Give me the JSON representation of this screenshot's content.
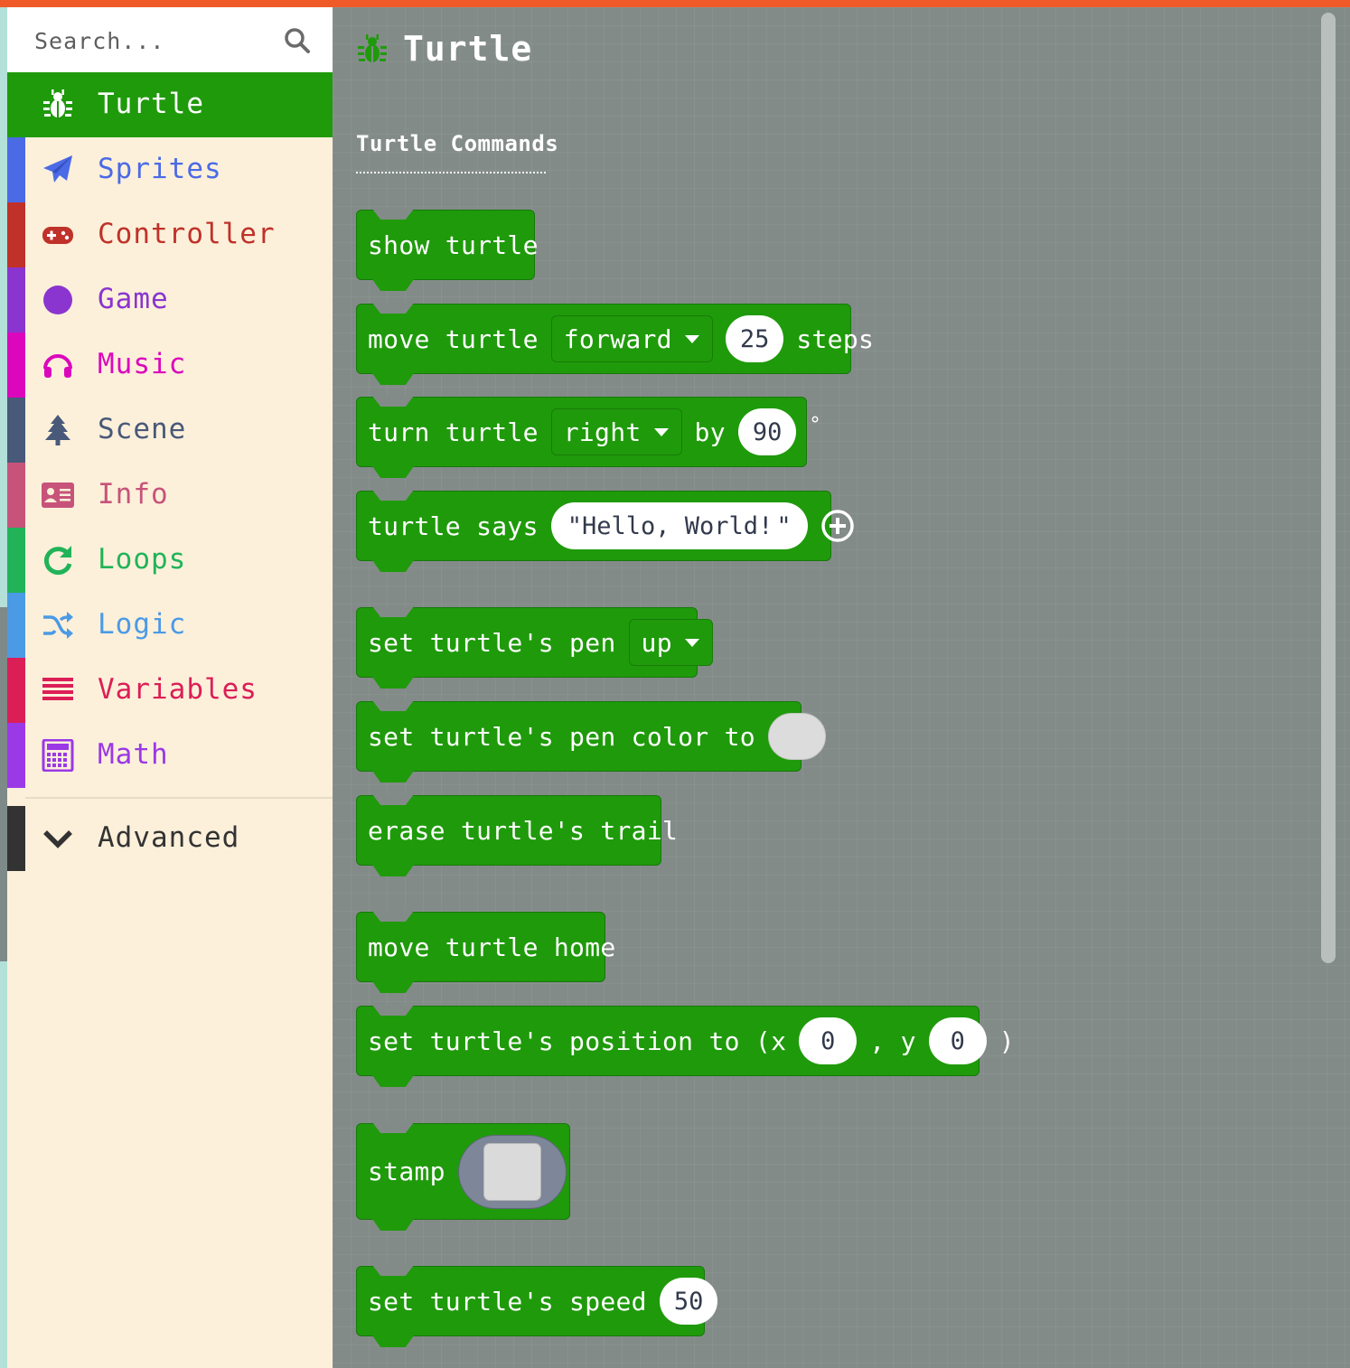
{
  "search": {
    "placeholder": "Search..."
  },
  "categories": [
    {
      "label": "Turtle",
      "color": "#1f9a0b",
      "icon": "bug-icon",
      "selected": true
    },
    {
      "label": "Sprites",
      "color": "#4b6ae6",
      "icon": "paper-plane-icon"
    },
    {
      "label": "Controller",
      "color": "#c0312a",
      "icon": "gamepad-icon"
    },
    {
      "label": "Game",
      "color": "#8a35cf",
      "icon": "circle-icon"
    },
    {
      "label": "Music",
      "color": "#dc07bc",
      "icon": "headphones-icon"
    },
    {
      "label": "Scene",
      "color": "#49597a",
      "icon": "tree-icon"
    },
    {
      "label": "Info",
      "color": "#c7537a",
      "icon": "id-card-icon"
    },
    {
      "label": "Loops",
      "color": "#22b359",
      "icon": "redo-icon"
    },
    {
      "label": "Logic",
      "color": "#4b9ae6",
      "icon": "shuffle-icon"
    },
    {
      "label": "Variables",
      "color": "#dc1e57",
      "icon": "list-icon"
    },
    {
      "label": "Math",
      "color": "#9b39e6",
      "icon": "calculator-icon"
    },
    {
      "label": "Advanced",
      "color": "#333333",
      "icon": "chevron-down-icon"
    }
  ],
  "workspace": {
    "title": "Turtle",
    "section": "Turtle Commands",
    "blocks": {
      "show_turtle": {
        "text": "show turtle"
      },
      "move_turtle": {
        "prefix": "move turtle",
        "direction": "forward",
        "steps": "25",
        "suffix": "steps"
      },
      "turn_turtle": {
        "prefix": "turn turtle",
        "direction": "right",
        "by": "by",
        "degrees": "90",
        "unit": "°"
      },
      "turtle_says": {
        "prefix": "turtle says",
        "open_quote": "\"",
        "message": "Hello, World!",
        "close_quote": "\""
      },
      "pen": {
        "prefix": "set turtle's pen",
        "state": "up"
      },
      "pen_color": {
        "prefix": "set turtle's pen color to",
        "color": "#dcdcdc"
      },
      "erase": {
        "text": "erase turtle's trail"
      },
      "home": {
        "text": "move turtle home"
      },
      "position": {
        "prefix": "set turtle's position to (x",
        "x": "0",
        "comma_y": ", y",
        "y": "0",
        "close": ")"
      },
      "stamp": {
        "text": "stamp"
      },
      "speed": {
        "prefix": "set turtle's speed",
        "value": "50"
      }
    }
  },
  "colors": {
    "accent": "#f05a28",
    "block_green": "#1f9a0b",
    "workspace_bg": "#838b89",
    "sidebar_bg": "#fcf0da"
  }
}
